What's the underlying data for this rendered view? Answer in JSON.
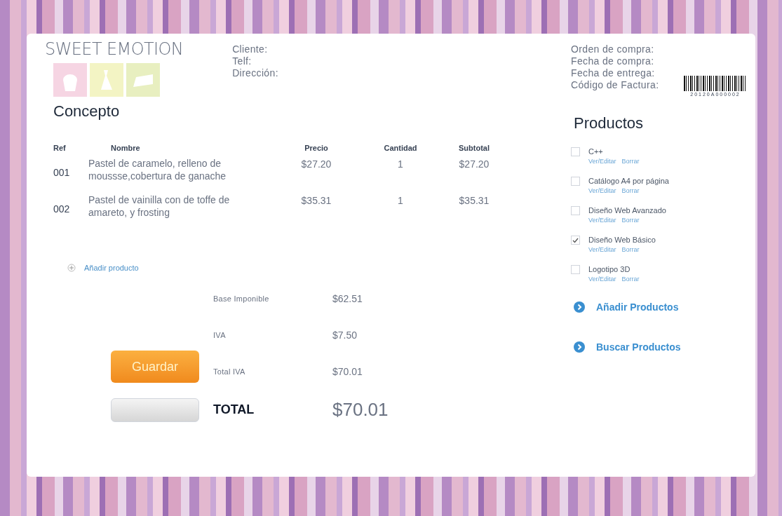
{
  "logo": {
    "text": "SWEET EMOTION"
  },
  "client_fields": [
    "Cliente:",
    "Telf:",
    "Dirección:"
  ],
  "order_fields": [
    "Orden de compra:",
    "Fecha de compra:",
    "Fecha de entrega:",
    "Código de Factura:"
  ],
  "barcode": {
    "number": "20120A000002"
  },
  "concept": {
    "title": "Concepto"
  },
  "table": {
    "columns": [
      "Ref",
      "Nombre",
      "Precio",
      "Cantidad",
      "Subtotal"
    ],
    "rows": [
      {
        "ref": "001",
        "name": "Pastel de caramelo, relleno de moussse,cobertura de ganache",
        "price": "$27.20",
        "qty": "1",
        "subtotal": "$27.20"
      },
      {
        "ref": "002",
        "name": "Pastel de vainilla con  de toffe de amareto, y frosting",
        "price": "$35.31",
        "qty": "1",
        "subtotal": "$35.31"
      }
    ]
  },
  "add_product_link": "Añadir producto",
  "totals": [
    {
      "label": "Base Imponible",
      "value": "$62.51",
      "kind": "normal"
    },
    {
      "label": "IVA",
      "value": "$7.50",
      "kind": "normal"
    },
    {
      "label": "Total IVA",
      "value": "$70.01",
      "kind": "normal"
    },
    {
      "label": "TOTAL",
      "value": "$70.01",
      "kind": "grand"
    }
  ],
  "save_button": "Guardar",
  "products": {
    "title": "Productos",
    "items": [
      {
        "name": "C++",
        "checked": false,
        "links": [
          "Ver/Editar",
          "Borrar"
        ]
      },
      {
        "name": "Catálogo A4 por página",
        "checked": false,
        "links": [
          "Ver/Editar",
          "Borrar"
        ]
      },
      {
        "name": "Diseño Web Avanzado",
        "checked": false,
        "links": [
          "Ver/Editar",
          "Borrar"
        ]
      },
      {
        "name": "Diseño Web Básico",
        "checked": true,
        "links": [
          "Ver/Editar",
          "Borrar"
        ]
      },
      {
        "name": "Logotipo 3D",
        "checked": false,
        "links": [
          "Ver/Editar",
          "Borrar"
        ]
      }
    ],
    "actions": [
      "Añadir Productos",
      "Buscar Productos"
    ]
  }
}
